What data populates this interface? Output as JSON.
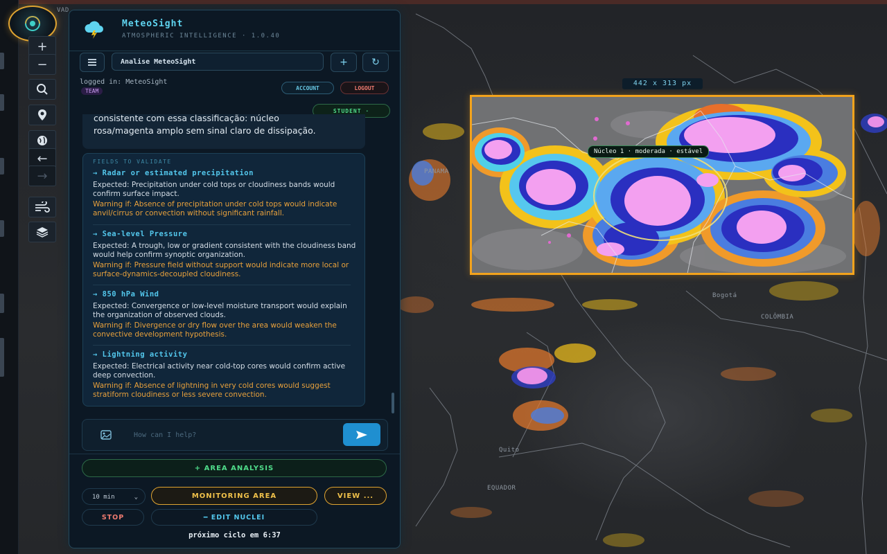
{
  "app": {
    "title": "MeteoSight",
    "subtitle": "ATMOSPHERIC INTELLIGENCE · 1.0.40"
  },
  "session": {
    "name": "Analise MeteoSight"
  },
  "user": {
    "logged_in": "logged in: MeteoSight",
    "team_badge": "TEAM",
    "account_label": "ACCOUNT",
    "logout_label": "LOGOUT",
    "role_label": "STUDENT ·"
  },
  "chat": {
    "previous_message_cut": "consistente com essa classificação: núcleo",
    "previous_message": "rosa/magenta amplo sem sinal claro de dissipação.",
    "fields_title": "FIELDS TO VALIDATE",
    "fields": [
      {
        "name": "→ Radar or estimated precipitation",
        "expected": "Expected: Precipitation under cold tops or cloudiness bands would confirm surface impact.",
        "warning": "Warning if: Absence of precipitation under cold tops would indicate anvil/cirrus or convection without significant rainfall."
      },
      {
        "name": "→ Sea-level Pressure",
        "expected": "Expected: A trough, low or gradient consistent with the cloudiness band would help confirm synoptic organization.",
        "warning": "Warning if: Pressure field without support would indicate more local or surface-dynamics-decoupled cloudiness."
      },
      {
        "name": "→ 850 hPa Wind",
        "expected": "Expected: Convergence or low-level moisture transport would explain the organization of observed clouds.",
        "warning": "Warning if: Divergence or dry flow over the area would weaken the convective development hypothesis."
      },
      {
        "name": "→ Lightning activity",
        "expected": "Expected: Electrical activity near cold-top cores would confirm active deep convection.",
        "warning": "Warning if: Absence of lightning in very cold cores would suggest stratiform cloudiness or less severe convection."
      }
    ],
    "input_placeholder": "How can I help?"
  },
  "actions": {
    "area_analysis": "+ AREA ANALYSIS",
    "interval": "10 min",
    "monitoring_area": "MONITORING AREA",
    "view": "VIEW ...",
    "stop": "STOP",
    "edit_nuclei": "━ EDIT NUCLEI",
    "next_cycle": "próximo ciclo em 6:37"
  },
  "map": {
    "selection_size": "442 x 313 px",
    "nucleus_label": "Núcleo 1 · moderada · estável",
    "places": {
      "panama": "PANAMA",
      "bogota": "Bogotá",
      "colombia": "COLÔMBIA",
      "quito": "Quito",
      "equador": "EQUADOR",
      "vad": "VAD"
    }
  },
  "colors": {
    "accent": "#53c7ec",
    "warning": "#e8a13c",
    "selection": "#f3a31c",
    "success": "#4fdb8a",
    "danger": "#f07b70"
  },
  "icons": [
    "menu-icon",
    "plus-icon",
    "refresh-icon",
    "image-icon",
    "send-icon",
    "zoom-in-icon",
    "zoom-out-icon",
    "search-icon",
    "location-pin-icon",
    "globe-icon",
    "arrow-left-icon",
    "arrow-right-icon",
    "wind-icon",
    "layers-icon",
    "logo-icon",
    "cloud-lightning-icon"
  ]
}
